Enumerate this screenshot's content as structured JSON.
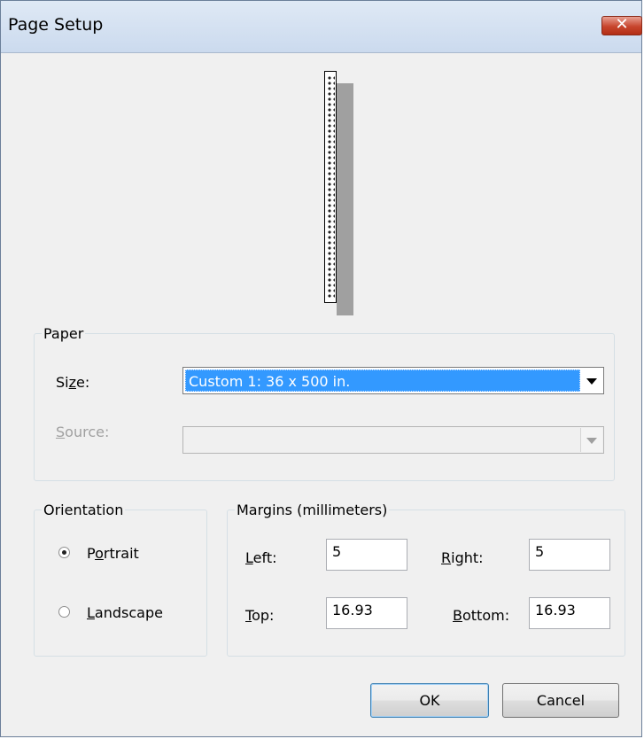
{
  "window": {
    "title": "Page Setup",
    "close_icon": "close-icon"
  },
  "preview": {
    "icon": "paper-preview-icon"
  },
  "paper": {
    "legend": "Paper",
    "size_label": "Size:",
    "size_value": "Custom 1: 36 x 500 in.",
    "source_label": "Source:",
    "source_value": ""
  },
  "orientation": {
    "legend": "Orientation",
    "options": [
      {
        "label": "Portrait",
        "checked": true
      },
      {
        "label": "Landscape",
        "checked": false
      }
    ]
  },
  "margins": {
    "legend": "Margins (millimeters)",
    "left_label": "Left:",
    "left_value": "5",
    "right_label": "Right:",
    "right_value": "5",
    "top_label": "Top:",
    "top_value": "16.93",
    "bottom_label": "Bottom:",
    "bottom_value": "16.93"
  },
  "buttons": {
    "ok": "OK",
    "cancel": "Cancel"
  },
  "colors": {
    "selection": "#3399ff",
    "close_button": "#c7452d",
    "title_bar": "#dfe9f5"
  }
}
